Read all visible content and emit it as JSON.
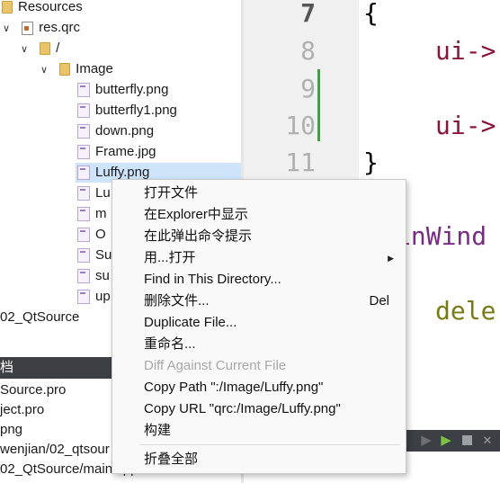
{
  "tree": {
    "resources_label": "Resources",
    "qrc_label": "res.qrc",
    "root_prefix_label": "/",
    "image_folder_label": "Image",
    "files": [
      "butterfly.png",
      "butterfly1.png",
      "down.png",
      "Frame.jpg",
      "Luffy.png",
      "Lu",
      "m",
      "O",
      "Su",
      "su",
      "up"
    ],
    "project_label": "02_QtSource"
  },
  "docs": {
    "header": "档",
    "items": [
      "Source.pro",
      "ject.pro",
      "png",
      "wenjian/02_qtsour",
      "02_QtSource/main.cpp"
    ]
  },
  "editor": {
    "line_numbers": [
      "7",
      "8",
      "9",
      "10",
      "11"
    ],
    "code_lines": [
      "{",
      "ui->",
      "ui->",
      "}",
      "inWind",
      "dele"
    ]
  },
  "context_menu": {
    "items": [
      {
        "label": "打开文件",
        "shortcut": ""
      },
      {
        "label": "在Explorer中显示",
        "shortcut": ""
      },
      {
        "label": "在此弹出命令提示",
        "shortcut": ""
      },
      {
        "label": "用...打开",
        "shortcut": "",
        "submenu": true
      },
      {
        "label": "Find in This Directory...",
        "shortcut": ""
      },
      {
        "label": "删除文件...",
        "shortcut": "Del"
      },
      {
        "label": "Duplicate File...",
        "shortcut": ""
      },
      {
        "label": "重命名...",
        "shortcut": ""
      },
      {
        "label": "Diff Against Current File",
        "shortcut": "",
        "disabled": true
      },
      {
        "label": "Copy Path \":/Image/Luffy.png\"",
        "shortcut": ""
      },
      {
        "label": "Copy URL \"qrc:/Image/Luffy.png\"",
        "shortcut": ""
      },
      {
        "label": "构建",
        "shortcut": ""
      },
      {
        "label": "折叠全部",
        "shortcut": ""
      }
    ]
  },
  "colors": {
    "selection": "#cde4fa",
    "panel_header": "#3c3f44",
    "change_marker": "#3aa53a"
  }
}
